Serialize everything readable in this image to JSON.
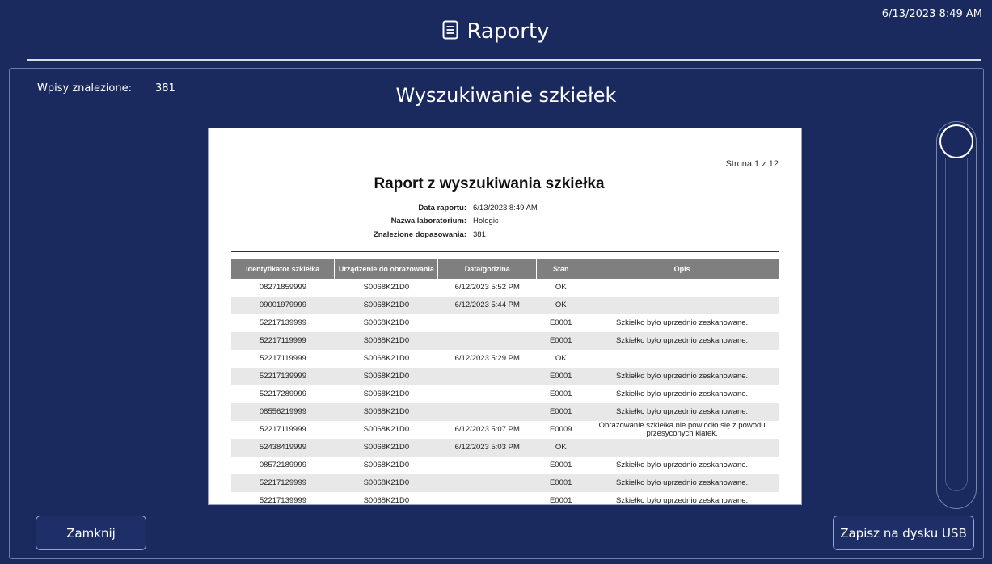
{
  "header": {
    "title": "Raporty",
    "icon": "document-icon",
    "datetime": "6/13/2023 8:49 AM"
  },
  "summary": {
    "entries_label": "Wpisy znalezione:",
    "entries_value": "381"
  },
  "page_title": "Wyszukiwanie szkiełek",
  "report": {
    "page_number": "Strona 1 z 12",
    "title": "Raport z wyszukiwania szkiełka",
    "meta": [
      {
        "label": "Data raportu:",
        "value": "6/13/2023 8:49 AM"
      },
      {
        "label": "Nazwa laboratorium:",
        "value": "Hologic"
      },
      {
        "label": "Znalezione dopasowania:",
        "value": "381"
      }
    ],
    "columns": [
      "Identyfikator szkiełka",
      "Urządzenie do obrazowania",
      "Data/godzina",
      "Stan",
      "Opis"
    ],
    "rows": [
      [
        "08271859999",
        "S0068K21D0",
        "6/12/2023 5:52 PM",
        "OK",
        ""
      ],
      [
        "09001979999",
        "S0068K21D0",
        "6/12/2023 5:44 PM",
        "OK",
        ""
      ],
      [
        "52217139999",
        "S0068K21D0",
        "",
        "E0001",
        "Szkiełko było uprzednio zeskanowane."
      ],
      [
        "52217119999",
        "S0068K21D0",
        "",
        "E0001",
        "Szkiełko było uprzednio zeskanowane."
      ],
      [
        "52217119999",
        "S0068K21D0",
        "6/12/2023 5:29 PM",
        "OK",
        ""
      ],
      [
        "52217139999",
        "S0068K21D0",
        "",
        "E0001",
        "Szkiełko było uprzednio zeskanowane."
      ],
      [
        "52217289999",
        "S0068K21D0",
        "",
        "E0001",
        "Szkiełko było uprzednio zeskanowane."
      ],
      [
        "08556219999",
        "S0068K21D0",
        "",
        "E0001",
        "Szkiełko było uprzednio zeskanowane."
      ],
      [
        "52217119999",
        "S0068K21D0",
        "6/12/2023 5:07 PM",
        "E0009",
        "Obrazowanie szkiełka nie powiodło się z powodu przesyconych klatek."
      ],
      [
        "52438419999",
        "S0068K21D0",
        "6/12/2023 5:03 PM",
        "OK",
        ""
      ],
      [
        "08572189999",
        "S0068K21D0",
        "",
        "E0001",
        "Szkiełko było uprzednio zeskanowane."
      ],
      [
        "52217129999",
        "S0068K21D0",
        "",
        "E0001",
        "Szkiełko było uprzednio zeskanowane."
      ],
      [
        "52217139999",
        "S0068K21D0",
        "",
        "E0001",
        "Szkiełko było uprzednio zeskanowane."
      ]
    ]
  },
  "scroll": {
    "position": 0.0
  },
  "buttons": {
    "close_label": "Zamknij",
    "usb_label": "Zapisz na dysku USB"
  },
  "colors": {
    "background": "#1b2a5e",
    "table_header": "#7f7f7f",
    "row_alt": "#e8e8e8"
  }
}
